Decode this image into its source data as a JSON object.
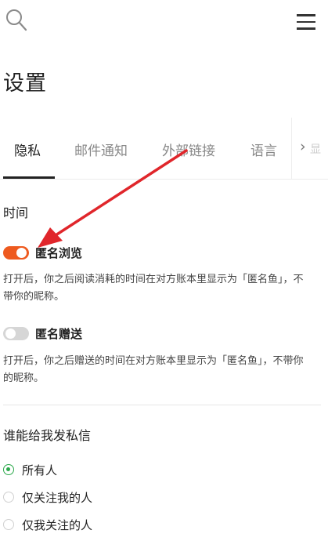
{
  "page": {
    "title": "设置"
  },
  "header": {
    "search_icon": "search-icon",
    "menu_icon": "hamburger-menu-icon"
  },
  "tabs": [
    {
      "label": "隐私",
      "active": true
    },
    {
      "label": "邮件通知",
      "active": false
    },
    {
      "label": "外部链接",
      "active": false
    },
    {
      "label": "语言",
      "active": false
    }
  ],
  "tabs_next": "›",
  "tabs_overflow": "显",
  "time_section": {
    "title": "时间"
  },
  "anonymous_browse": {
    "label": "匿名浏览",
    "enabled": true,
    "description": "打开后，你之后阅读消耗的时间在对方账本里显示为「匿名鱼」，不带你的昵称。"
  },
  "anonymous_gift": {
    "label": "匿名赠送",
    "enabled": false,
    "description": "打开后，你之后赠送的时间在对方账本里显示为「匿名鱼」，不带你的昵称。"
  },
  "messages": {
    "title": "谁能给我发私信",
    "options": [
      {
        "label": "所有人",
        "checked": true
      },
      {
        "label": "仅关注我的人",
        "checked": false
      },
      {
        "label": "仅我关注的人",
        "checked": false
      }
    ]
  },
  "colors": {
    "toggle_on": "#ee5a1f",
    "radio_checked": "#2aa84a",
    "annotation_arrow": "#e0262b"
  }
}
